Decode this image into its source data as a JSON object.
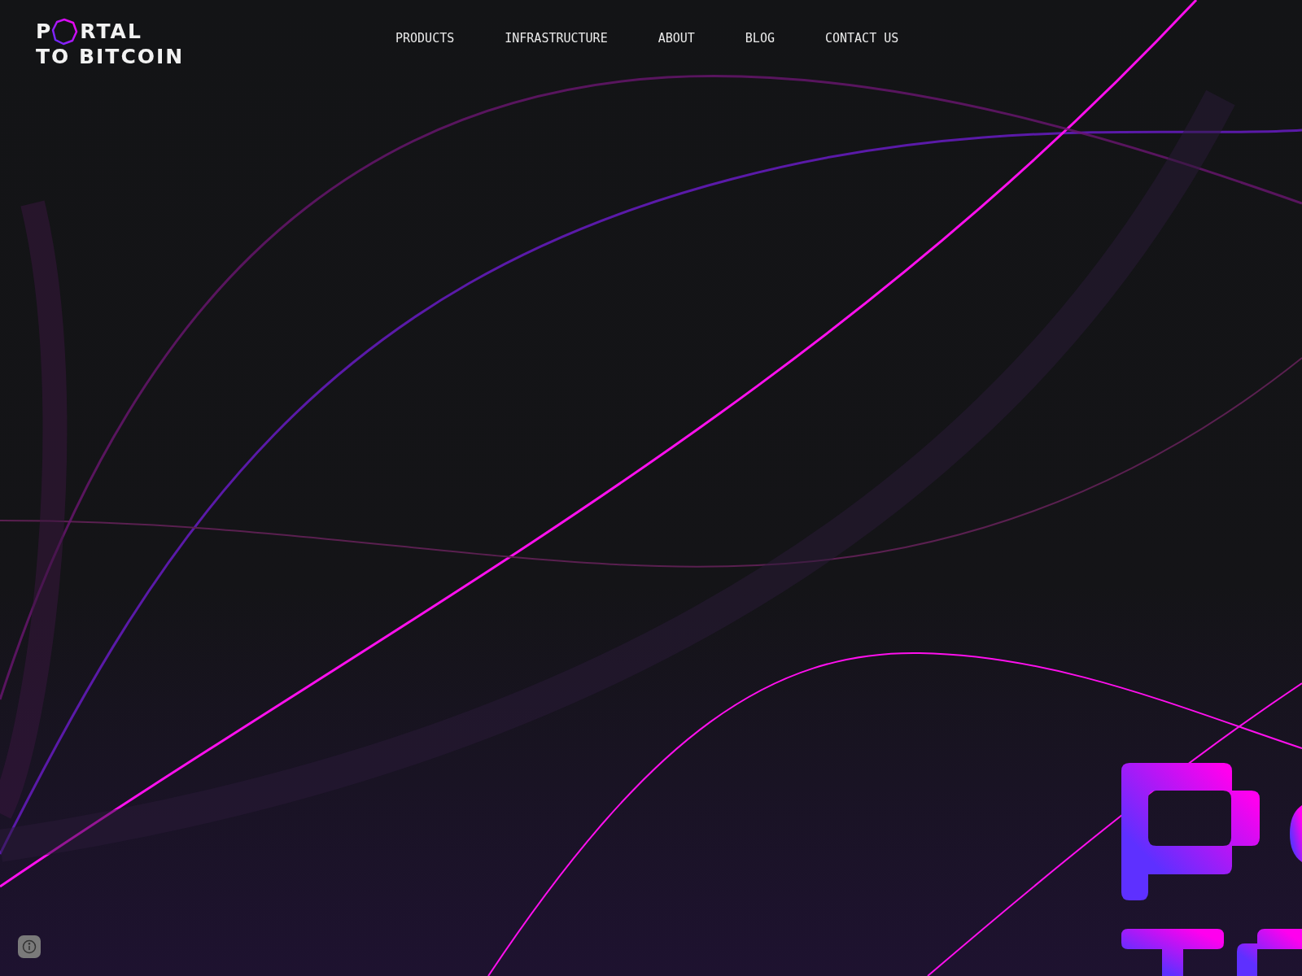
{
  "logo": {
    "first": "P",
    "rest": "RTAL",
    "second_line": "TO BITCOIN"
  },
  "nav": [
    {
      "label": "PRODUCTS"
    },
    {
      "label": "INFRASTRUCTURE"
    },
    {
      "label": "ABOUT"
    },
    {
      "label": "BLOG"
    },
    {
      "label": "CONTACT US"
    }
  ]
}
